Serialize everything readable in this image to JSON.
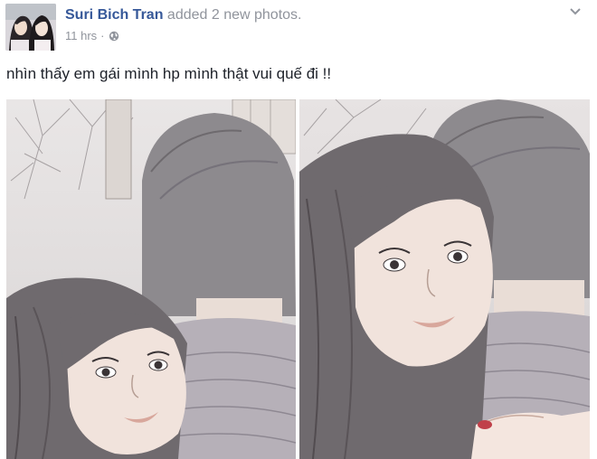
{
  "post": {
    "author": "Suri Bich Tran",
    "action": "added 2 new photos.",
    "time": "11 hrs",
    "separator": "·",
    "privacy_icon": "globe-icon",
    "menu_icon": "chevron-down-icon",
    "status_text": "nhìn thấy em gái mình hp mình thật vui quế đi !!"
  },
  "photos": [
    {
      "name": "photo-1"
    },
    {
      "name": "photo-2"
    }
  ],
  "colors": {
    "author_link": "#365899",
    "meta_text": "#90949c",
    "body_text": "#1d2129"
  }
}
